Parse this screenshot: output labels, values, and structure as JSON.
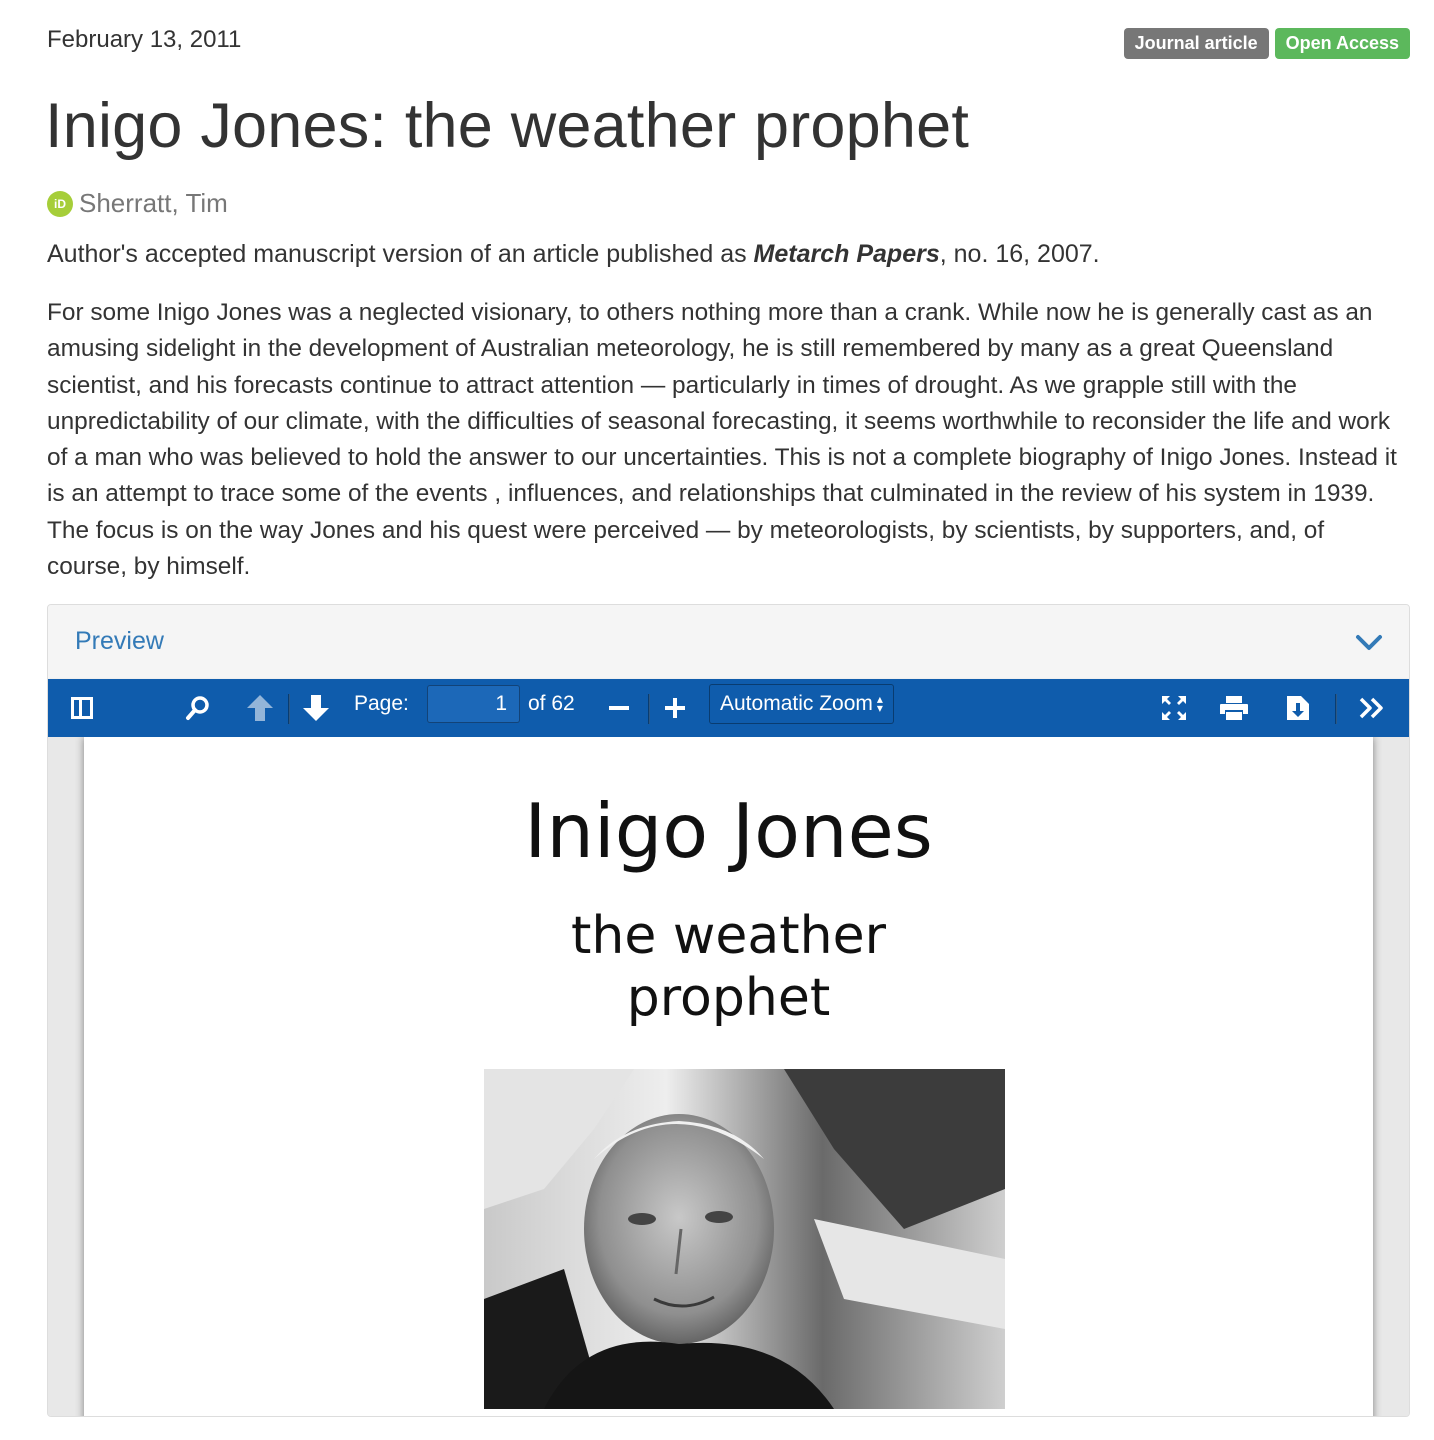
{
  "date": "February 13, 2011",
  "badges": {
    "type": "Journal article",
    "access": "Open Access"
  },
  "title": "Inigo Jones: the weather prophet",
  "author": {
    "name": "Sherratt, Tim",
    "orcid_label": "iD"
  },
  "version": {
    "prefix": "Author's accepted manuscript version of an article published as ",
    "journal": "Metarch Papers",
    "suffix": ", no. 16, 2007."
  },
  "abstract": "For some Inigo Jones was a neglected visionary, to others nothing more than a crank. While now he is generally cast as an amusing sidelight in the development of Australian meteorology, he is still remembered by many as a great Queensland scientist, and his forecasts continue to attract attention — particularly in times of drought. As we grapple still with the unpredictability of our climate, with the difficulties of seasonal forecasting, it seems worthwhile to reconsider the life and work of a man who was believed to hold the answer to our uncertainties. This is not a complete biography of Inigo Jones. Instead it is an attempt to trace some of the events , influences, and relationships that culminated in the review of his system in 1939. The focus is on the way Jones and his quest were perceived — by meteorologists, by scientists, by supporters, and, of course, by himself.",
  "preview": {
    "heading": "Preview",
    "toolbar": {
      "page_label": "Page:",
      "page_value": "1",
      "page_total": "of 62",
      "zoom_value": "Automatic Zoom"
    },
    "pdf": {
      "title": "Inigo Jones",
      "subtitle_line1": "the weather",
      "subtitle_line2": "prophet"
    }
  },
  "colors": {
    "toolbar": "#0f5cac",
    "link": "#337ab7",
    "badge_grey": "#777777",
    "badge_green": "#5cb85c",
    "orcid": "#a6ce39"
  },
  "icons": [
    "orcid-icon",
    "chevron-down-icon",
    "sidebar-toggle-icon",
    "search-icon",
    "arrow-up-icon",
    "arrow-down-icon",
    "zoom-out-icon",
    "zoom-in-icon",
    "fullscreen-icon",
    "print-icon",
    "download-icon",
    "double-chevron-right-icon"
  ]
}
